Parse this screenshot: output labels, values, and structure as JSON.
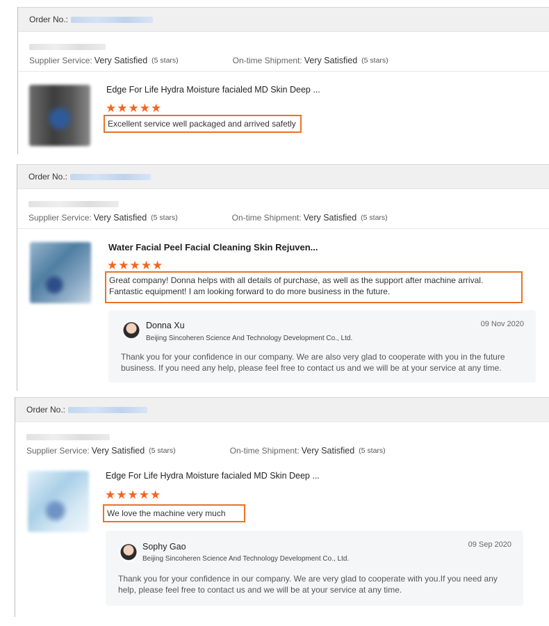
{
  "order_label": "Order No.:",
  "supplier_label": "Supplier Service:",
  "shipment_label": "On-time Shipment:",
  "reviews": [
    {
      "supplier_value": "Very Satisfied",
      "supplier_stars": "(5 stars)",
      "shipment_value": "Very Satisfied",
      "shipment_stars": "(5 stars)",
      "product_title": "Edge For Life Hydra Moisture facialed MD Skin Deep ...",
      "stars": "★★★★★",
      "rating": 5,
      "comment": "Excellent service well packaged and arrived safetly"
    },
    {
      "supplier_value": "Very Satisfied",
      "supplier_stars": "(5 stars)",
      "shipment_value": "Very Satisfied",
      "shipment_stars": "(5 stars)",
      "product_title": "Water Facial Peel Facial Cleaning Skin Rejuven...",
      "stars": "★★★★★",
      "rating": 5,
      "comment": "Great company! Donna helps with all details of purchase, as well as the support after machine arrival. Fantastic equipment! I am looking forward to do more business in the future.",
      "reply": {
        "name": "Donna Xu",
        "company": "Beijing Sincoheren Science And Technology Development Co., Ltd.",
        "date": "09 Nov 2020",
        "text": "Thank you for your confidence in our company. We are also very glad to cooperate with you in the future business. If you need any help, please feel free to contact us and we will be at your service at any time."
      }
    },
    {
      "supplier_value": "Very Satisfied",
      "supplier_stars": "(5 stars)",
      "shipment_value": "Very Satisfied",
      "shipment_stars": "(5 stars)",
      "product_title": "Edge For Life Hydra Moisture facialed MD Skin Deep ...",
      "stars": "★★★★★",
      "rating": 5,
      "comment": "We love the machine very much",
      "reply": {
        "name": "Sophy Gao",
        "company": "Beijing Sincoheren Science And Technology Development Co., Ltd.",
        "date": "09 Sep 2020",
        "text": "Thank you for your confidence in our company. We are very glad to cooperate with you.If you need any help, please feel free to contact us and we will be at your service at any time."
      }
    }
  ],
  "colors": {
    "accent": "#f26522",
    "highlight_border": "#e8722b",
    "header_bg": "#f0f0f0"
  }
}
